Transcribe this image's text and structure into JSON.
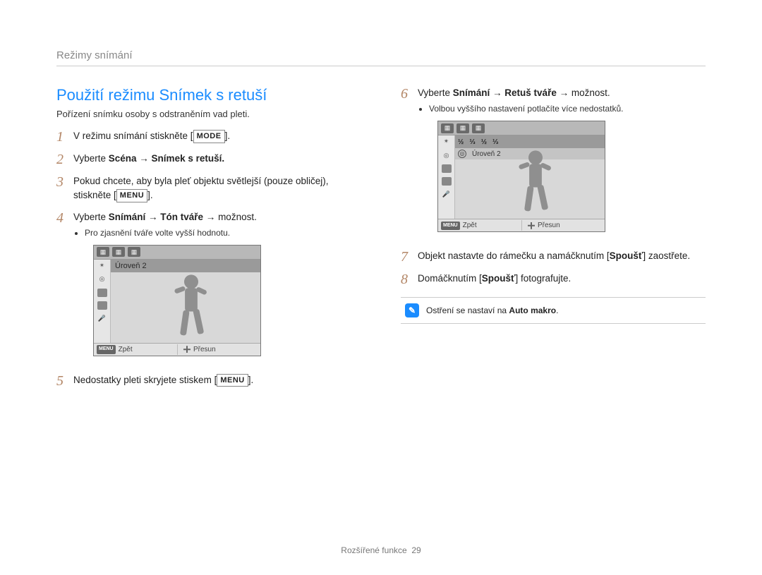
{
  "header": "Režimy snímání",
  "title": "Použití režimu Snímek s retuší",
  "subtitle": "Pořízení snímku osoby s odstraněním vad pleti.",
  "steps_left": [
    {
      "n": "1",
      "pre": "V režimu snímání stiskněte [",
      "kbd": "MODE",
      "post": "]."
    },
    {
      "n": "2",
      "html": "Vyberte <b>Scéna → Snímek s retuší.</b>"
    },
    {
      "n": "3",
      "pre": "Pokud chcete, aby byla pleť objektu světlejší (pouze obličej), stiskněte [",
      "kbd": "MENU",
      "post": "]."
    },
    {
      "n": "4",
      "html": "Vyberte <b>Snímání → Tón tváře →</b> možnost.",
      "sub": "Pro zjasnění tváře volte vyšší hodnotu."
    },
    {
      "n": "5",
      "pre": "Nedostatky pleti skryjete stiskem [",
      "kbd": "MENU",
      "post": "]."
    }
  ],
  "steps_right": [
    {
      "n": "6",
      "html": "Vyberte <b>Snímání → Retuš tváře →</b> možnost.",
      "sub": "Volbou vyššího nastavení potlačíte více nedostatků."
    },
    {
      "n": "7",
      "html": "Objekt nastavte do rámečku a namáčknutím [<b>Spoušť</b>] zaostřete."
    },
    {
      "n": "8",
      "html": "Domáčknutím [<b>Spoušť</b>] fotografujte."
    }
  ],
  "lcd": {
    "level_label": "Úroveň 2",
    "fractions": [
      "½",
      "⅓",
      "½",
      "⅓"
    ],
    "back": "Zpět",
    "move": "Přesun",
    "menu": "MENU"
  },
  "note": {
    "text_pre": "Ostření se nastaví na ",
    "bold": "Auto makro",
    "text_post": "."
  },
  "footer": {
    "section": "Rozšířené funkce",
    "page": "29"
  }
}
